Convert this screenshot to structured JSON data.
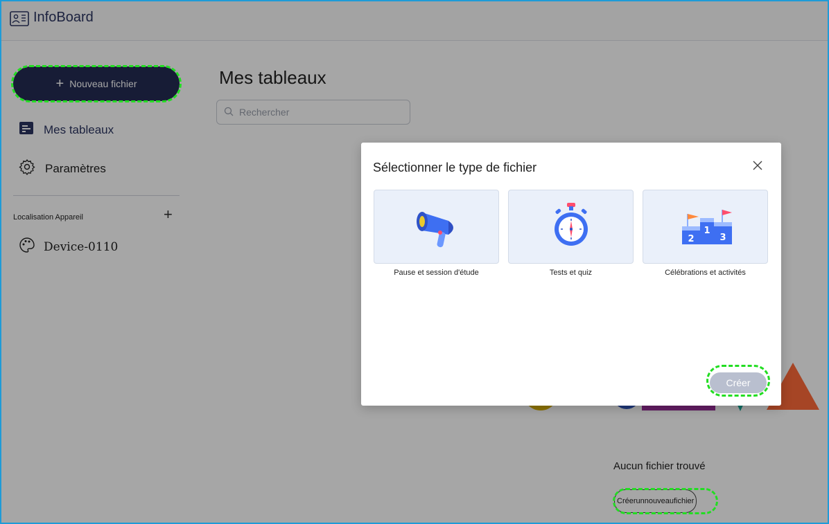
{
  "app": {
    "title": "InfoBoard"
  },
  "sidebar": {
    "new_file_label": "Nouveau fichier",
    "items": [
      {
        "label": "Mes tableaux",
        "icon": "board-icon"
      },
      {
        "label": "Paramètres",
        "icon": "gear-icon"
      }
    ],
    "location_label": "Localisation Appareil",
    "device": {
      "label": "Device-0110",
      "icon": "palette-icon"
    }
  },
  "main": {
    "title": "Mes tableaux",
    "search_placeholder": "Rechercher",
    "empty_text": "Aucun fichier trouvé",
    "create_link": "Créerunnouveaufichier"
  },
  "modal": {
    "title": "Sélectionner le type de fichier",
    "options": [
      {
        "label": "Pause et session d'étude",
        "icon": "megaphone-icon"
      },
      {
        "label": "Tests et quiz",
        "icon": "stopwatch-icon"
      },
      {
        "label": "Célébrations et activités",
        "icon": "podium-icon"
      }
    ],
    "create_button": "Créer"
  },
  "colors": {
    "primary": "#242c54",
    "accent_text": "#2b3561",
    "highlight": "#22dd22",
    "tile_bg": "#eaf0fa",
    "button_disabled": "#b9bfcf"
  }
}
